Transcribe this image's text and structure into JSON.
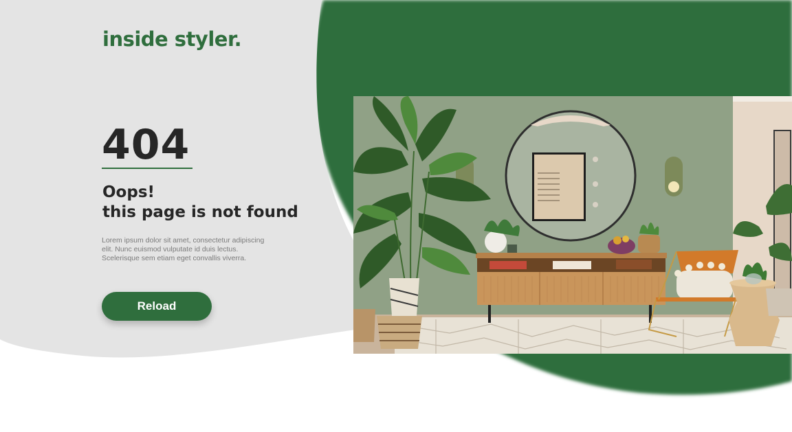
{
  "brand": {
    "logo_text": "inside styler."
  },
  "error": {
    "code": "404",
    "heading_line1": "Oops!",
    "heading_line2": "this page is not found",
    "description": "Lorem ipsum dolor sit amet, consectetur adipiscing elit. Nunc euismod vulputate id duis lectus. Scelerisque sem etiam eget convallis viverra."
  },
  "actions": {
    "reload_label": "Reload"
  },
  "colors": {
    "brand_green": "#2f6e3d",
    "panel_grey": "#e4e4e4",
    "text_dark": "#262626",
    "text_muted": "#7a7a7a",
    "background": "#ffffff"
  },
  "photo": {
    "subject": "living-room-interior-photo"
  }
}
